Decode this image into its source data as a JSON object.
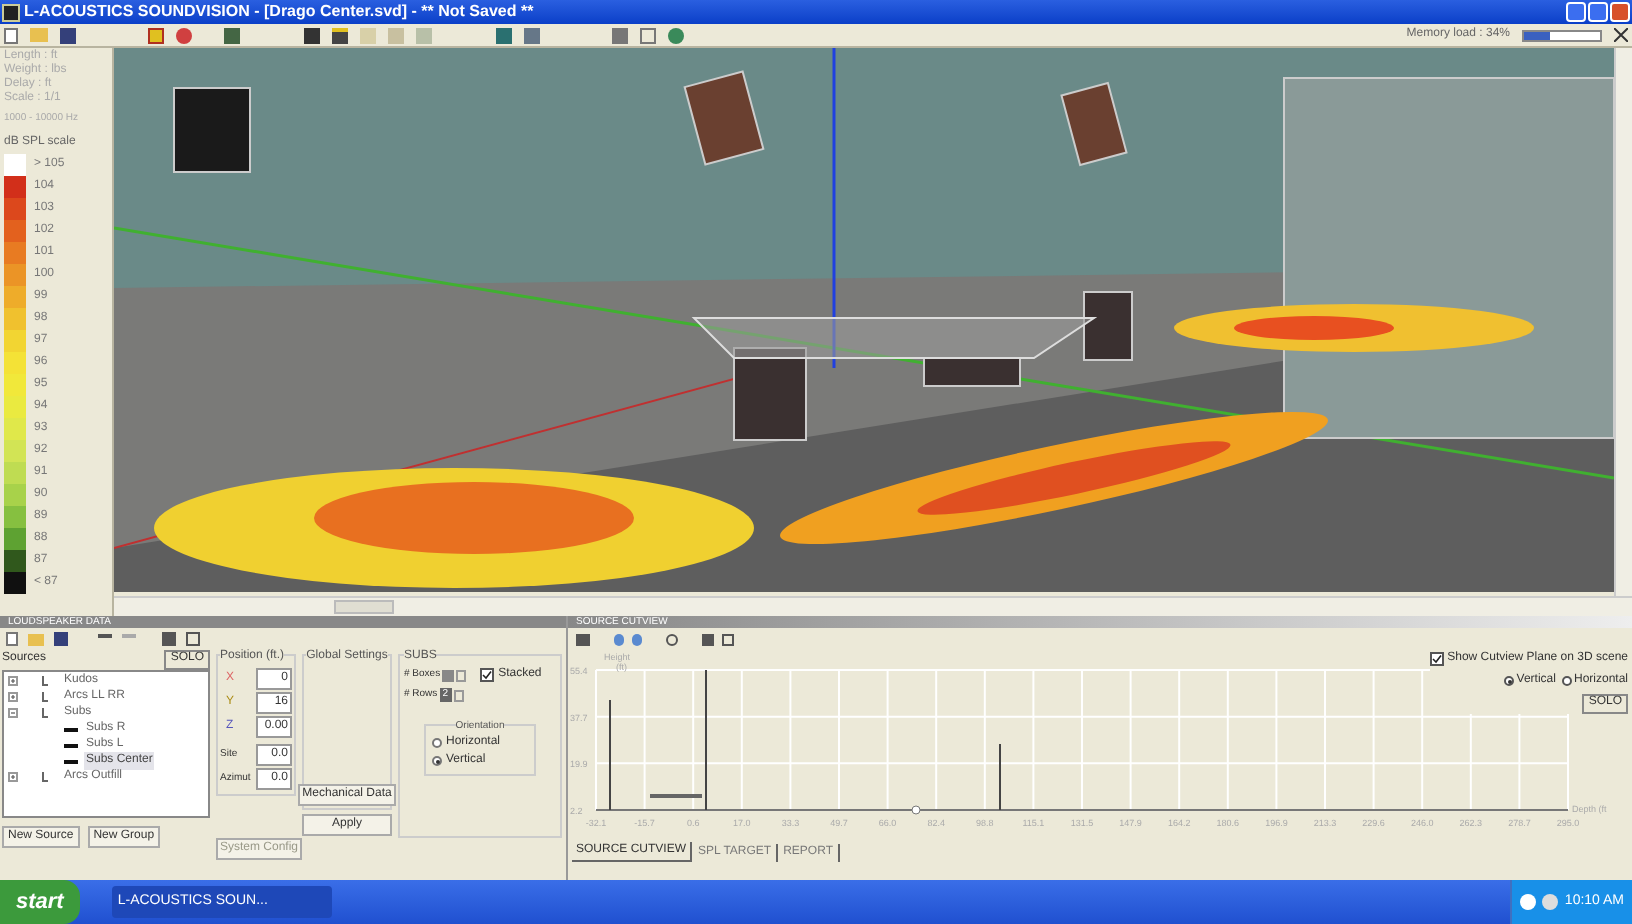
{
  "window": {
    "title": "L-ACOUSTICS SOUNDVISION - [Drago Center.svd] - ** Not Saved **"
  },
  "memory": {
    "label": "Memory load : 34%",
    "level": 0.34
  },
  "info": [
    "Length : ft",
    "Weight : lbs",
    "Delay : ft",
    "Scale : 1/1"
  ],
  "frequency": "1000 - 10000 Hz",
  "spl_scale": {
    "title": "dB SPL scale",
    "steps": [
      {
        "label": "> 105",
        "color": "#ffffff"
      },
      {
        "label": "104",
        "color": "#d22f1a"
      },
      {
        "label": "103",
        "color": "#dc481c"
      },
      {
        "label": "102",
        "color": "#e3611e"
      },
      {
        "label": "101",
        "color": "#e87b22"
      },
      {
        "label": "100",
        "color": "#eb9426"
      },
      {
        "label": "99",
        "color": "#eeac2a"
      },
      {
        "label": "98",
        "color": "#f0c12e"
      },
      {
        "label": "97",
        "color": "#f2d532"
      },
      {
        "label": "96",
        "color": "#f4e236"
      },
      {
        "label": "95",
        "color": "#f1e83a"
      },
      {
        "label": "94",
        "color": "#eaea40"
      },
      {
        "label": "93",
        "color": "#e0e84a"
      },
      {
        "label": "92",
        "color": "#d2e455"
      },
      {
        "label": "91",
        "color": "#bfdc52"
      },
      {
        "label": "90",
        "color": "#a8d24a"
      },
      {
        "label": "89",
        "color": "#86c040"
      },
      {
        "label": "88",
        "color": "#5ea232"
      },
      {
        "label": "87",
        "color": "#30581c"
      },
      {
        "label": "< 87",
        "color": "#101010"
      }
    ]
  },
  "loudspeaker_data": {
    "title": "LOUDSPEAKER DATA",
    "sources_label": "Sources",
    "solo": "SOLO",
    "sources": [
      {
        "label": "Kudos",
        "expanded": false,
        "selected": false
      },
      {
        "label": "Arcs LL RR",
        "expanded": false,
        "selected": false
      },
      {
        "label": "Subs",
        "expanded": true,
        "selected": false,
        "children": [
          {
            "label": "Subs R",
            "selected": false
          },
          {
            "label": "Subs L",
            "selected": false
          },
          {
            "label": "Subs Center",
            "selected": true
          }
        ]
      },
      {
        "label": "Arcs Outfill",
        "expanded": false,
        "selected": false
      }
    ],
    "position": {
      "title": "Position (ft.)",
      "fields": [
        {
          "label": "X",
          "value": "0"
        },
        {
          "label": "Y",
          "value": "16"
        },
        {
          "label": "Z",
          "value": "0.00"
        }
      ],
      "angles": [
        {
          "label": "Site",
          "value": "0.0"
        },
        {
          "label": "Azimut",
          "value": "0.0"
        }
      ]
    },
    "global_settings": "Global Settings",
    "mechanical_data": "Mechanical Data",
    "subs": {
      "title": "SUBS",
      "boxes_label": "# Boxes",
      "rows_label": "# Rows",
      "rows_value": "2",
      "stacked": {
        "label": "Stacked",
        "checked": true
      },
      "orientation": {
        "title": "Orientation",
        "options": [
          {
            "label": "Horizontal",
            "selected": false
          },
          {
            "label": "Vertical",
            "selected": true
          }
        ]
      }
    },
    "buttons": [
      "New Source",
      "New Group",
      "System Config",
      "Apply"
    ]
  },
  "cutview": {
    "title": "SOURCE CUTVIEW",
    "ylabel": "Height\n(ft)",
    "xlabel": "Depth (ft",
    "yticks": [
      "55.4",
      "37.7",
      "19.9",
      "2.2"
    ],
    "xticks": [
      "-32.1",
      "-15.7",
      "0.6",
      "17.0",
      "33.3",
      "49.7",
      "66.0",
      "82.4",
      "98.8",
      "115.1",
      "131.5",
      "147.9",
      "164.2",
      "180.6",
      "196.9",
      "213.3",
      "229.6",
      "246.0",
      "262.3",
      "278.7",
      "295.0"
    ],
    "show_plane": {
      "label": "Show Cutview Plane on 3D scene",
      "checked": true
    },
    "plane": [
      {
        "label": "Vertical",
        "selected": true
      },
      {
        "label": "Horizontal",
        "selected": false
      }
    ],
    "solo": "SOLO",
    "tabs": [
      {
        "label": "SOURCE CUTVIEW",
        "selected": true
      },
      {
        "label": "SPL TARGET",
        "selected": false
      },
      {
        "label": "REPORT",
        "selected": false
      }
    ]
  },
  "taskbar": {
    "start": "start",
    "task": "L-ACOUSTICS SOUN...",
    "time": "10:10 AM"
  }
}
